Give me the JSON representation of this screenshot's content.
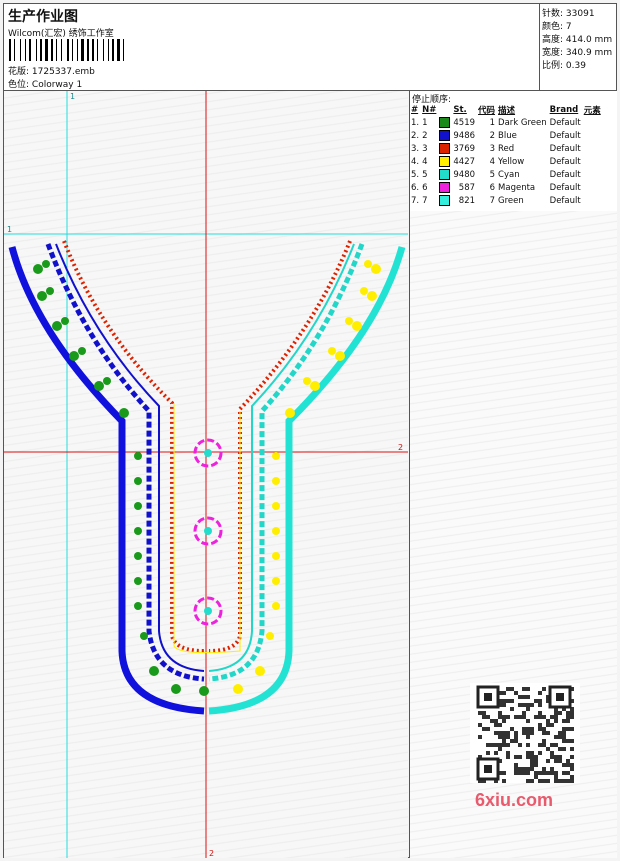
{
  "header": {
    "title": "生产作业图",
    "company": "Wilcom(汇宏) 绣饰工作室",
    "design_label": "花版:",
    "design_file": "1725337.emb",
    "colorway_label": "色位:",
    "colorway": "Colorway 1"
  },
  "stats": {
    "stitches_label": "针数:",
    "stitches": "33091",
    "colors_label": "颜色:",
    "colors": "7",
    "height_label": "高度:",
    "height": "414.0 mm",
    "width_label": "宽度:",
    "width": "340.9 mm",
    "scale_label": "比例:",
    "scale": "0.39"
  },
  "stop_sequence": {
    "title": "停止顺序:",
    "headers": [
      "#",
      "N#",
      "St.",
      "代码",
      "描述",
      "Brand",
      "元素"
    ],
    "rows": [
      {
        "idx": "1.",
        "n": "1",
        "color": "#1a8a1a",
        "st": "4519",
        "code": "1",
        "desc": "Dark Green",
        "brand": "Default"
      },
      {
        "idx": "2.",
        "n": "2",
        "color": "#1111cc",
        "st": "9486",
        "code": "2",
        "desc": "Blue",
        "brand": "Default"
      },
      {
        "idx": "3.",
        "n": "3",
        "color": "#dd2200",
        "st": "3769",
        "code": "3",
        "desc": "Red",
        "brand": "Default"
      },
      {
        "idx": "4.",
        "n": "4",
        "color": "#ffee00",
        "st": "4427",
        "code": "4",
        "desc": "Yellow",
        "brand": "Default"
      },
      {
        "idx": "5.",
        "n": "5",
        "color": "#22ddcc",
        "st": "9480",
        "code": "5",
        "desc": "Cyan",
        "brand": "Default"
      },
      {
        "idx": "6.",
        "n": "6",
        "color": "#ee22dd",
        "st": "587",
        "code": "6",
        "desc": "Magenta",
        "brand": "Default"
      },
      {
        "idx": "7.",
        "n": "7",
        "color": "#33eedd",
        "st": "821",
        "code": "7",
        "desc": "Green",
        "brand": "Default"
      }
    ]
  },
  "guides": {
    "v1": "1",
    "h1": "1",
    "h2": "2",
    "v2": "2"
  },
  "watermark": {
    "brand": "6xiu.com"
  }
}
